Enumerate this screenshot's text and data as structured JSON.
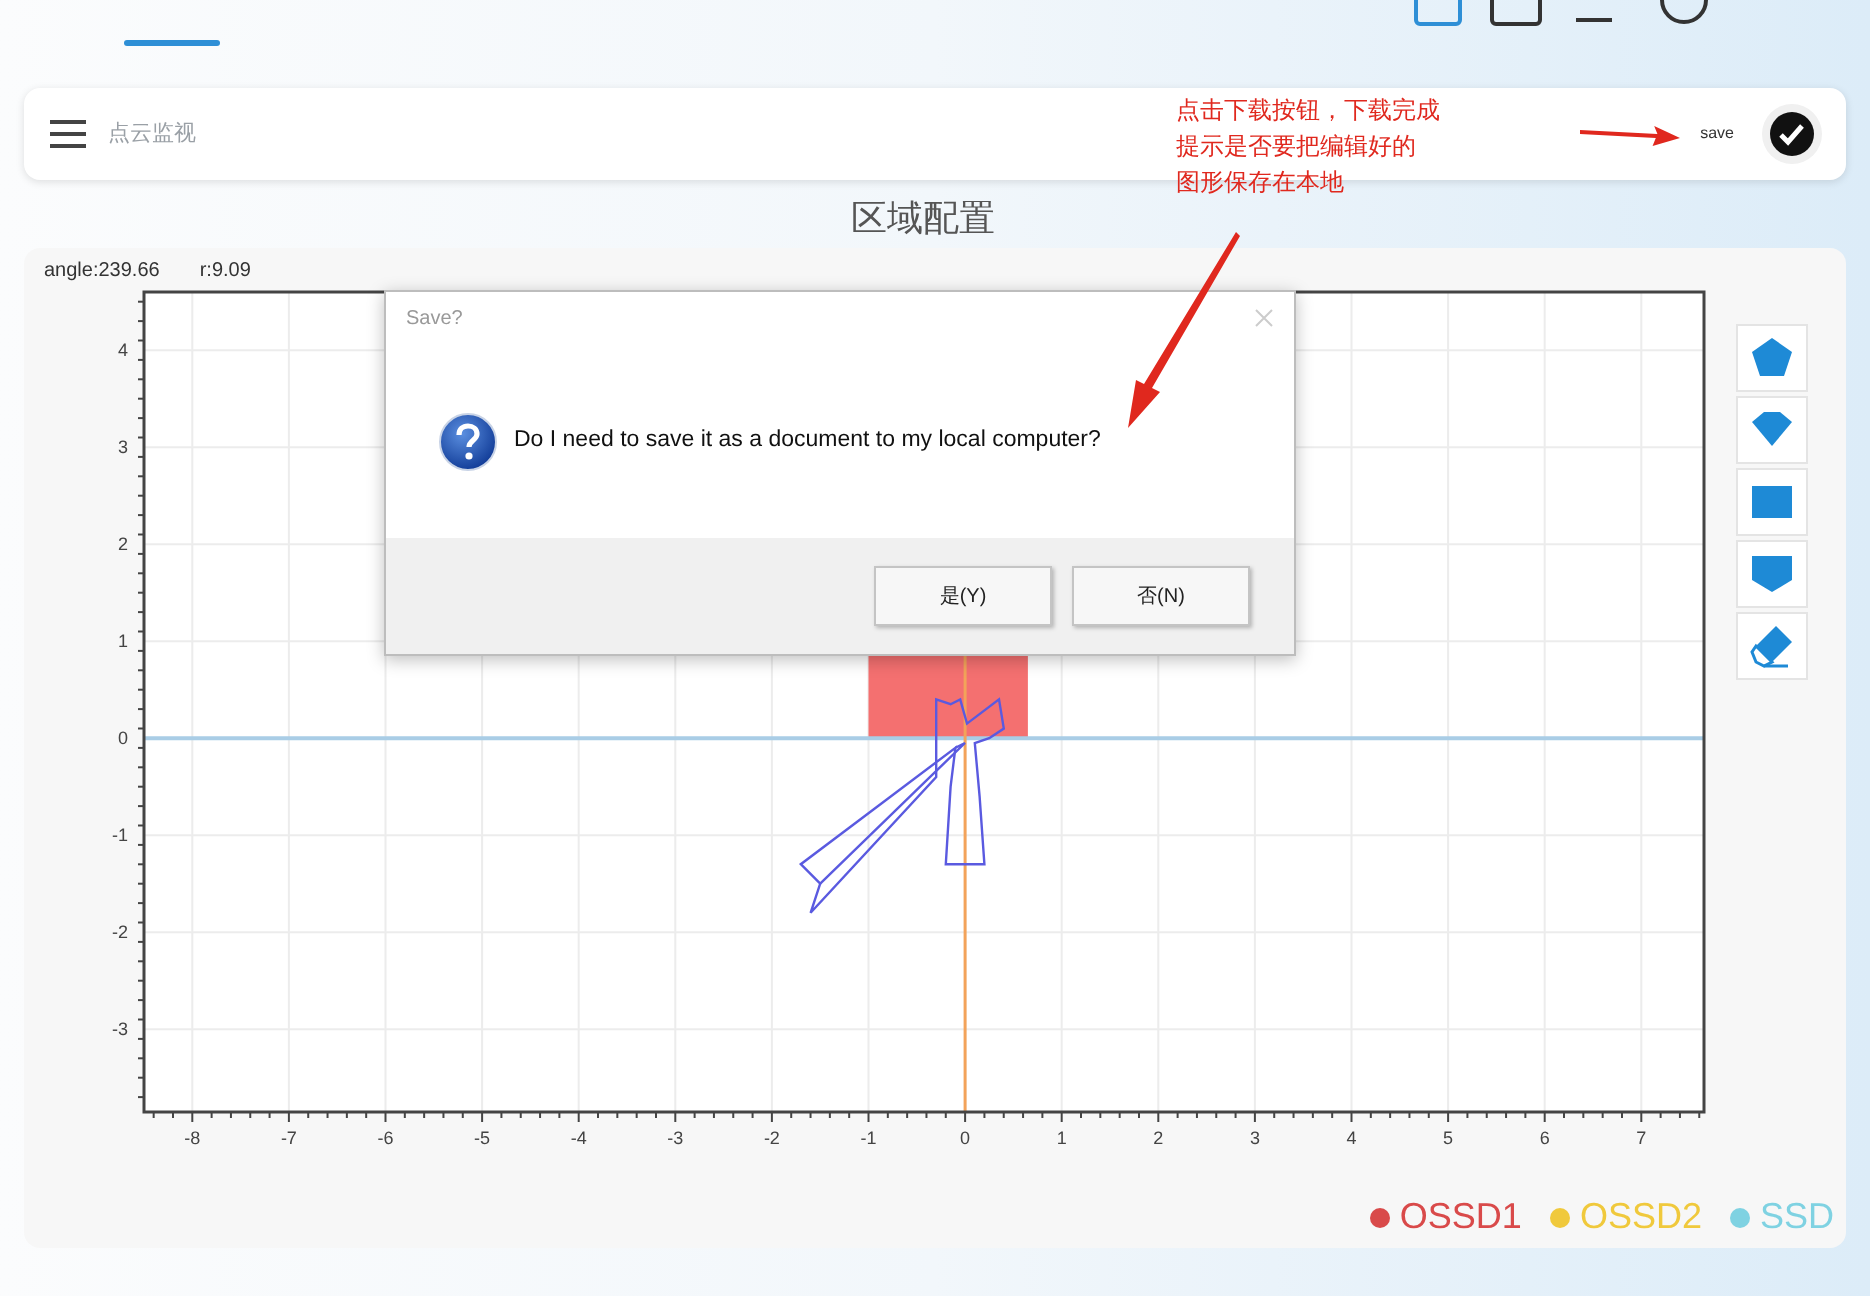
{
  "toolbar": {
    "title": "点云监视",
    "save_label": "save"
  },
  "annotation": {
    "lines": [
      "点击下载按钮，下载完成",
      "提示是否要把编辑好的",
      "图形保存在本地"
    ]
  },
  "page_title": "区域配置",
  "readout": [
    "angle:239.66",
    "r:9.09"
  ],
  "plot": {
    "x_ticks": [
      "-8",
      "-7",
      "-6",
      "-5",
      "-4",
      "-3",
      "-2",
      "-1",
      "0",
      "1",
      "2",
      "3",
      "4",
      "5",
      "6",
      "7"
    ],
    "y_ticks": [
      "4",
      "3",
      "2",
      "1",
      "0",
      "-1",
      "-2",
      "-3"
    ]
  },
  "tools": [
    {
      "kind": "pentagon"
    },
    {
      "kind": "diamond"
    },
    {
      "kind": "rectangle"
    },
    {
      "kind": "shield"
    },
    {
      "kind": "eraser"
    }
  ],
  "legend": [
    {
      "label": "OSSD1",
      "color": "#d94a4a"
    },
    {
      "label": "OSSD2",
      "color": "#f0c93c"
    },
    {
      "label": "SSD",
      "color": "#7fd2e2"
    }
  ],
  "dialog": {
    "title": "Save?",
    "message": "Do I need to save it as a document to my local computer?",
    "buttons": [
      "是(Y)",
      "否(N)"
    ]
  }
}
